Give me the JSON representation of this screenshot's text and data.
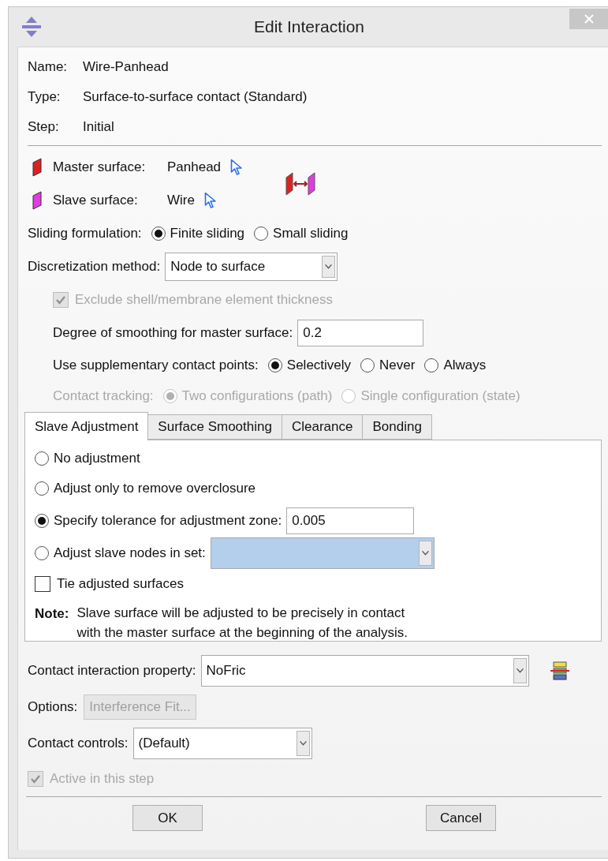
{
  "window": {
    "title": "Edit Interaction"
  },
  "info": [
    {
      "label": "Name:",
      "value": "Wire-Panhead"
    },
    {
      "label": "Type:",
      "value": "Surface-to-surface contact (Standard)"
    },
    {
      "label": "Step:",
      "value": "Initial"
    }
  ],
  "surfaces": [
    {
      "kind": "master",
      "label": "Master surface:",
      "value": "Panhead"
    },
    {
      "kind": "slave",
      "label": "Slave surface:",
      "value": "Wire"
    }
  ],
  "sliding": {
    "label": "Sliding formulation:",
    "options": [
      {
        "label": "Finite sliding",
        "selected": true
      },
      {
        "label": "Small sliding",
        "selected": false
      }
    ]
  },
  "discretization": {
    "label": "Discretization method:",
    "value": "Node to surface"
  },
  "exclude_thickness": {
    "label": "Exclude shell/membrane element thickness",
    "checked": true,
    "disabled": true
  },
  "smoothing": {
    "label": "Degree of smoothing for master surface:",
    "value": "0.2"
  },
  "supplementary": {
    "label": "Use supplementary contact points:",
    "disabled": false,
    "options": [
      {
        "label": "Selectively",
        "selected": true
      },
      {
        "label": "Never",
        "selected": false
      },
      {
        "label": "Always",
        "selected": false
      }
    ]
  },
  "tracking": {
    "label": "Contact tracking:",
    "disabled": true,
    "options": [
      {
        "label": "Two configurations (path)",
        "selected": true
      },
      {
        "label": "Single configuration (state)",
        "selected": false
      }
    ]
  },
  "tabs": [
    {
      "label": "Slave Adjustment",
      "selected": true
    },
    {
      "label": "Surface Smoothing",
      "selected": false
    },
    {
      "label": "Clearance",
      "selected": false
    },
    {
      "label": "Bonding",
      "selected": false
    }
  ],
  "adjustment": {
    "options": [
      {
        "kind": "plain",
        "label": "No adjustment",
        "selected": false
      },
      {
        "kind": "plain",
        "label": "Adjust only to remove overclosure",
        "selected": false
      },
      {
        "kind": "tolerance",
        "label": "Specify tolerance for adjustment zone:",
        "selected": true,
        "value": "0.005"
      },
      {
        "kind": "set",
        "label": "Adjust slave nodes in set:",
        "selected": false,
        "disabled": true
      }
    ],
    "tie": {
      "label": "Tie adjusted surfaces",
      "checked": false
    },
    "note": {
      "label": "Note:",
      "lines": [
        "Slave surface will be adjusted to be precisely in contact",
        "with the master surface at the beginning of the analysis."
      ]
    }
  },
  "property": {
    "label": "Contact interaction property:",
    "value": "NoFric"
  },
  "options": {
    "label": "Options:",
    "button": "Interference Fit...",
    "disabled": true
  },
  "controls": {
    "label": "Contact controls:",
    "value": "(Default)"
  },
  "active": {
    "label": "Active in this step",
    "checked": true,
    "disabled": true
  },
  "buttons": [
    {
      "label": "OK"
    },
    {
      "label": "Cancel"
    }
  ]
}
